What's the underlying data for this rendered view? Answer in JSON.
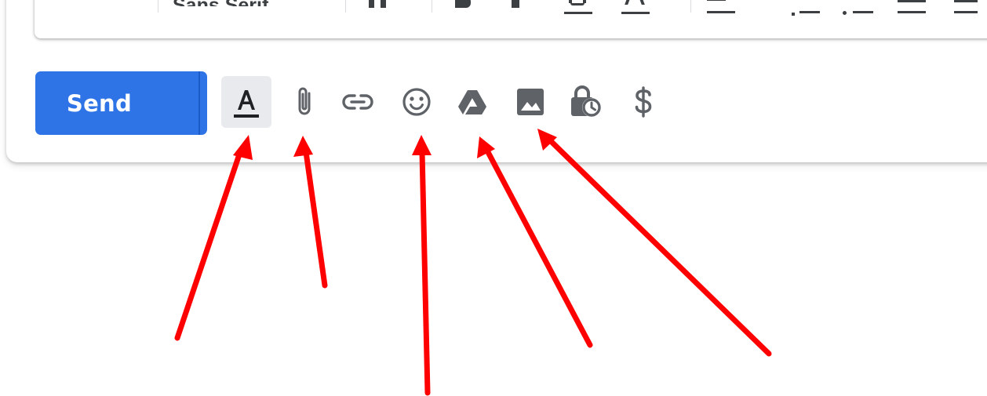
{
  "format_bar": {
    "font_name": "Sans Serif"
  },
  "send": {
    "label": "Send",
    "more_options_icon": "triangle-down-icon"
  },
  "toolbar": {
    "items": [
      {
        "name": "formatting-options",
        "icon": "text-format-icon",
        "active": true
      },
      {
        "name": "attach-files",
        "icon": "paperclip-icon"
      },
      {
        "name": "insert-link",
        "icon": "link-icon"
      },
      {
        "name": "insert-emoji",
        "icon": "smiley-icon"
      },
      {
        "name": "insert-drive-file",
        "icon": "drive-icon"
      },
      {
        "name": "insert-photo",
        "icon": "image-icon"
      },
      {
        "name": "confidential-mode",
        "icon": "lock-clock-icon"
      },
      {
        "name": "send-money",
        "icon": "dollar-icon"
      }
    ]
  },
  "colors": {
    "send_blue": "#2f74e6",
    "icon_gray": "#5f6368",
    "active_bg": "#e8eaed",
    "arrow_red": "#ff0000"
  }
}
